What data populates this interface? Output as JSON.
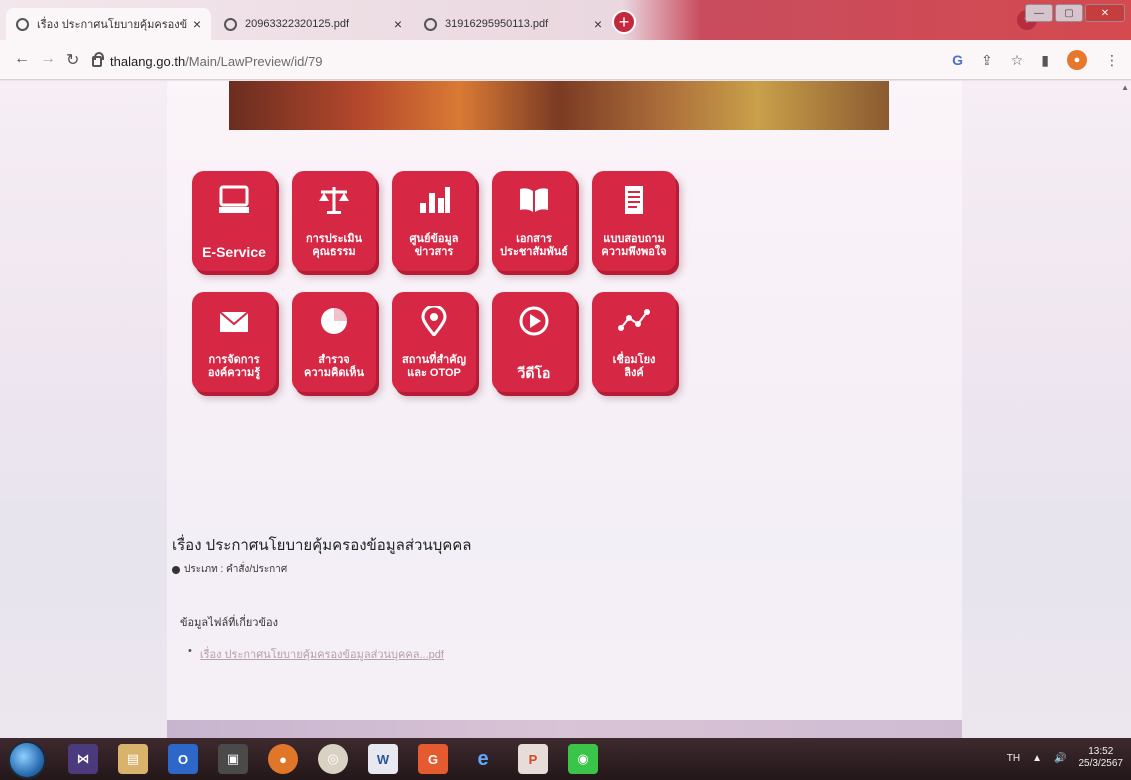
{
  "browser": {
    "tabs": [
      {
        "title": "เรื่อง ประกาศนโยบายคุ้มครองข้อมู",
        "active": true
      },
      {
        "title": "20963322320125.pdf",
        "active": false
      },
      {
        "title": "31916295950113.pdf",
        "active": false
      }
    ],
    "new_tab": "+",
    "url_host": "thalang.go.th",
    "url_path": "/Main/LawPreview/id/79"
  },
  "page": {
    "tiles_row1": [
      {
        "label": "E-Service",
        "icon": "computer-icon"
      },
      {
        "label": "การประเมิน\nคุณธรรม",
        "icon": "scales-icon"
      },
      {
        "label": "ศูนย์ข้อมูล\nข่าวสาร",
        "icon": "bar-chart-icon"
      },
      {
        "label": "เอกสาร\nประชาสัมพันธ์",
        "icon": "book-icon"
      },
      {
        "label": "แบบสอบถาม\nความพึงพอใจ",
        "icon": "document-icon"
      }
    ],
    "tiles_row2": [
      {
        "label": "การจัดการ\nองค์ความรู้",
        "icon": "envelope-icon"
      },
      {
        "label": "สำรวจ\nความคิดเห็น",
        "icon": "pie-chart-icon"
      },
      {
        "label": "สถานที่สำคัญ\nและ OTOP",
        "icon": "location-pin-icon"
      },
      {
        "label": "วีดีโอ",
        "icon": "play-icon"
      },
      {
        "label": "เชื่อมโยง\nลิงค์",
        "icon": "link-nodes-icon"
      }
    ],
    "article_title": "เรื่อง ประกาศนโยบายคุ้มครองข้อมูลส่วนบุคคล",
    "meta": "ประเภท : คำสั่ง/ประกาศ",
    "related_heading": "ข้อมูลไฟล์ที่เกี่ยวข้อง",
    "file_link": "เรื่อง ประกาศนโยบายคุ้มครองข้อมูลส่วนบุคคล...pdf"
  },
  "taskbar": {
    "language": "TH",
    "time": "13:52",
    "date": "25/3/2567"
  }
}
